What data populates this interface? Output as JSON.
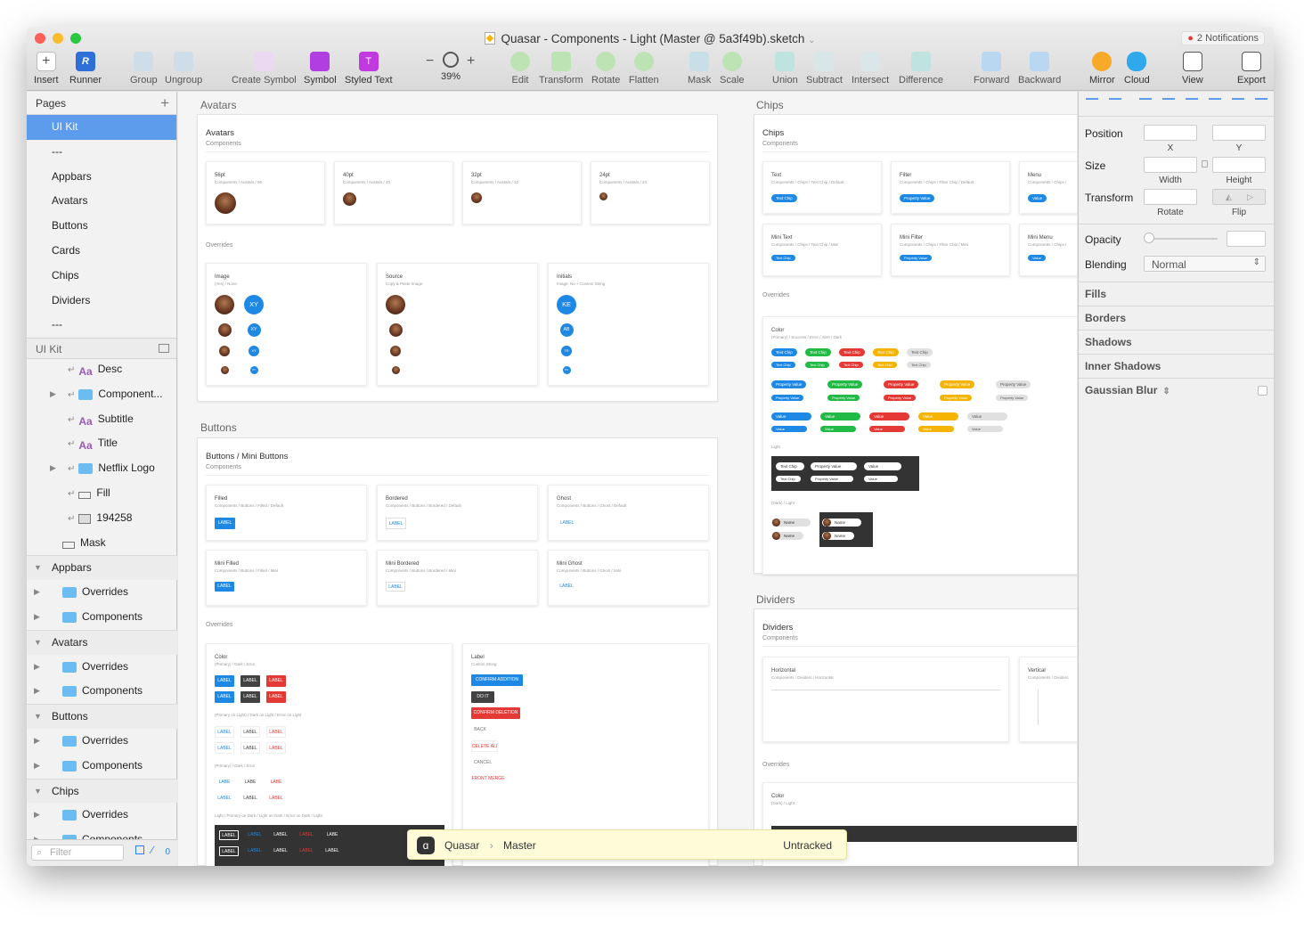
{
  "window": {
    "title": "Quasar - Components - Light (Master @ 5a3f49b).sketch",
    "notifications": "2 Notifications"
  },
  "toolbar": {
    "insert": "Insert",
    "runner": "Runner",
    "group": "Group",
    "ungroup": "Ungroup",
    "create_symbol": "Create Symbol",
    "symbol": "Symbol",
    "styled_text": "Styled Text",
    "zoom_minus": "−",
    "zoom_plus": "+",
    "zoom": "39%",
    "edit": "Edit",
    "transform": "Transform",
    "rotate": "Rotate",
    "flatten": "Flatten",
    "mask": "Mask",
    "scale": "Scale",
    "union": "Union",
    "subtract": "Subtract",
    "intersect": "Intersect",
    "difference": "Difference",
    "forward": "Forward",
    "backward": "Backward",
    "mirror": "Mirror",
    "cloud": "Cloud",
    "view": "View",
    "export": "Export"
  },
  "sidebar": {
    "pages_label": "Pages",
    "pages": [
      "UI Kit",
      "---",
      "Appbars",
      "Avatars",
      "Buttons",
      "Cards",
      "Chips",
      "Dividers",
      "---"
    ],
    "layers_header": "UI Kit",
    "layers": [
      {
        "label": "Desc",
        "kind": "text",
        "indent": 2
      },
      {
        "label": "Component...",
        "kind": "folder",
        "indent": 2,
        "arrow": true
      },
      {
        "label": "Subtitle",
        "kind": "text",
        "indent": 2
      },
      {
        "label": "Title",
        "kind": "text",
        "indent": 2
      },
      {
        "label": "Netflix Logo",
        "kind": "folder",
        "indent": 2,
        "arrow": true
      },
      {
        "label": "Fill",
        "kind": "rect",
        "indent": 2
      },
      {
        "label": "194258",
        "kind": "image",
        "indent": 2
      },
      {
        "label": "Mask",
        "kind": "rect",
        "indent": 1
      },
      {
        "label": "Appbars",
        "kind": "group",
        "indent": 0
      },
      {
        "label": "Overrides",
        "kind": "folder",
        "indent": 1,
        "arrow": true
      },
      {
        "label": "Components",
        "kind": "folder",
        "indent": 1,
        "arrow": true
      },
      {
        "label": "Avatars",
        "kind": "group",
        "indent": 0
      },
      {
        "label": "Overrides",
        "kind": "folder",
        "indent": 1,
        "arrow": true
      },
      {
        "label": "Components",
        "kind": "folder",
        "indent": 1,
        "arrow": true
      },
      {
        "label": "Buttons",
        "kind": "group",
        "indent": 0
      },
      {
        "label": "Overrides",
        "kind": "folder",
        "indent": 1,
        "arrow": true
      },
      {
        "label": "Components",
        "kind": "folder",
        "indent": 1,
        "arrow": true
      },
      {
        "label": "Chips",
        "kind": "group",
        "indent": 0
      },
      {
        "label": "Overrides",
        "kind": "folder",
        "indent": 1,
        "arrow": true
      },
      {
        "label": "Components",
        "kind": "folder",
        "indent": 1,
        "arrow": true
      }
    ],
    "filter_placeholder": "Filter",
    "count": "0"
  },
  "canvas": {
    "avatars": {
      "label": "Avatars",
      "title": "Avatars",
      "subtitle": "Components",
      "cards": [
        {
          "t": "56pt",
          "s": "Components / Avatars / 56"
        },
        {
          "t": "40pt",
          "s": "Components / Avatars / 40"
        },
        {
          "t": "32pt",
          "s": "Components / Avatars / 32"
        },
        {
          "t": "24pt",
          "s": "Components / Avatars / 24"
        }
      ],
      "overrides": "Overrides",
      "ocards": [
        {
          "t": "Image",
          "s": "(Yes) / None"
        },
        {
          "t": "Source",
          "s": "Copy & Paste Image"
        },
        {
          "t": "Initials",
          "s": "Image: No + Custom String"
        }
      ],
      "initials": [
        "XY",
        "XY",
        "XY",
        "XY",
        "KE",
        "AB",
        "TR",
        "PU"
      ]
    },
    "buttons": {
      "label": "Buttons",
      "title": "Buttons / Mini Buttons",
      "subtitle": "Components",
      "cards": [
        {
          "t": "Filled",
          "s": "Components / Buttons / Filled / Default"
        },
        {
          "t": "Bordered",
          "s": "Components / Buttons / Bordered / Default"
        },
        {
          "t": "Ghost",
          "s": "Components / Buttons / Ghost / Default"
        },
        {
          "t": "Mini Filled",
          "s": "Components / Buttons / Filled / Mini"
        },
        {
          "t": "Mini Bordered",
          "s": "Components / Buttons / Bordered / Mini"
        },
        {
          "t": "Mini Ghost",
          "s": "Components / Buttons / Ghost / Mini"
        }
      ],
      "btn_label": "LABEL",
      "btn_label_short": "LABE",
      "overrides": "Overrides",
      "color_t": "Color",
      "color_s": "(Primary) / Dark / Error",
      "color_s2": "(Primary on Light) / Dark on Light / Error on Light",
      "color_s3": "(Primary) / Dark / Error",
      "color_s4": "Light / Primary on Dark / Light on Dark / Error on Dark / Light",
      "label_t": "Label",
      "label_s": "Custom String",
      "label_items": [
        "CONFIRM ADDITION",
        "DO IT",
        "CONFIRM DELETION",
        "BACK",
        "DELETE ALL",
        "CANCEL",
        "FRONT MERGE"
      ]
    },
    "chips": {
      "label": "Chips",
      "title": "Chips",
      "subtitle": "Components",
      "cards": [
        {
          "t": "Text",
          "s": "Components / Chips / Text Chip / Default",
          "chip": "Text Chip"
        },
        {
          "t": "Filter",
          "s": "Components / Chips / Filter Chip / Default",
          "chip": "Property Value"
        },
        {
          "t": "Menu",
          "s": "Components / Chips /",
          "chip": "Value"
        },
        {
          "t": "Mini Text",
          "s": "Components / Chips / Text Chip / Mini",
          "chip": "Text Chip"
        },
        {
          "t": "Mini Filter",
          "s": "Components / Chips / Filter Chip / Mini",
          "chip": "Property Value"
        },
        {
          "t": "Mini Menu",
          "s": "Components / Chips /",
          "chip": "Value"
        }
      ],
      "overrides": "Overrides",
      "color_t": "Color",
      "color_s": "(Primary) / Success / Error / Alert / Dark",
      "text_chip": "Text Chip",
      "property_value": "Property Value",
      "value": "Value",
      "light": "Light",
      "dark_light": "(Dark) / Light",
      "name": "Name"
    },
    "dividers": {
      "label": "Dividers",
      "title": "Dividers",
      "subtitle": "Components",
      "cards": [
        {
          "t": "Horizontal",
          "s": "Components / Dividers / Horizontal"
        },
        {
          "t": "Vertical",
          "s": "Components / Dividers"
        }
      ],
      "overrides": "Overrides",
      "color_t": "Color",
      "color_s": "(Dark) / Light"
    }
  },
  "inspector": {
    "position": "Position",
    "x": "X",
    "y": "Y",
    "size": "Size",
    "width": "Width",
    "height": "Height",
    "transform": "Transform",
    "rotate": "Rotate",
    "flip": "Flip",
    "opacity": "Opacity",
    "blending": "Blending",
    "blending_value": "Normal",
    "sections": [
      "Fills",
      "Borders",
      "Shadows",
      "Inner Shadows",
      "Gaussian Blur"
    ]
  },
  "toast": {
    "repo": "Quasar",
    "branch": "Master",
    "status": "Untracked"
  },
  "colors": {
    "primary": "#1e88e5",
    "success": "#21ba45",
    "error": "#e53935",
    "alert": "#f5b400",
    "dark": "#424242",
    "light": "#e0e0e0",
    "selection": "#5d9cec"
  }
}
